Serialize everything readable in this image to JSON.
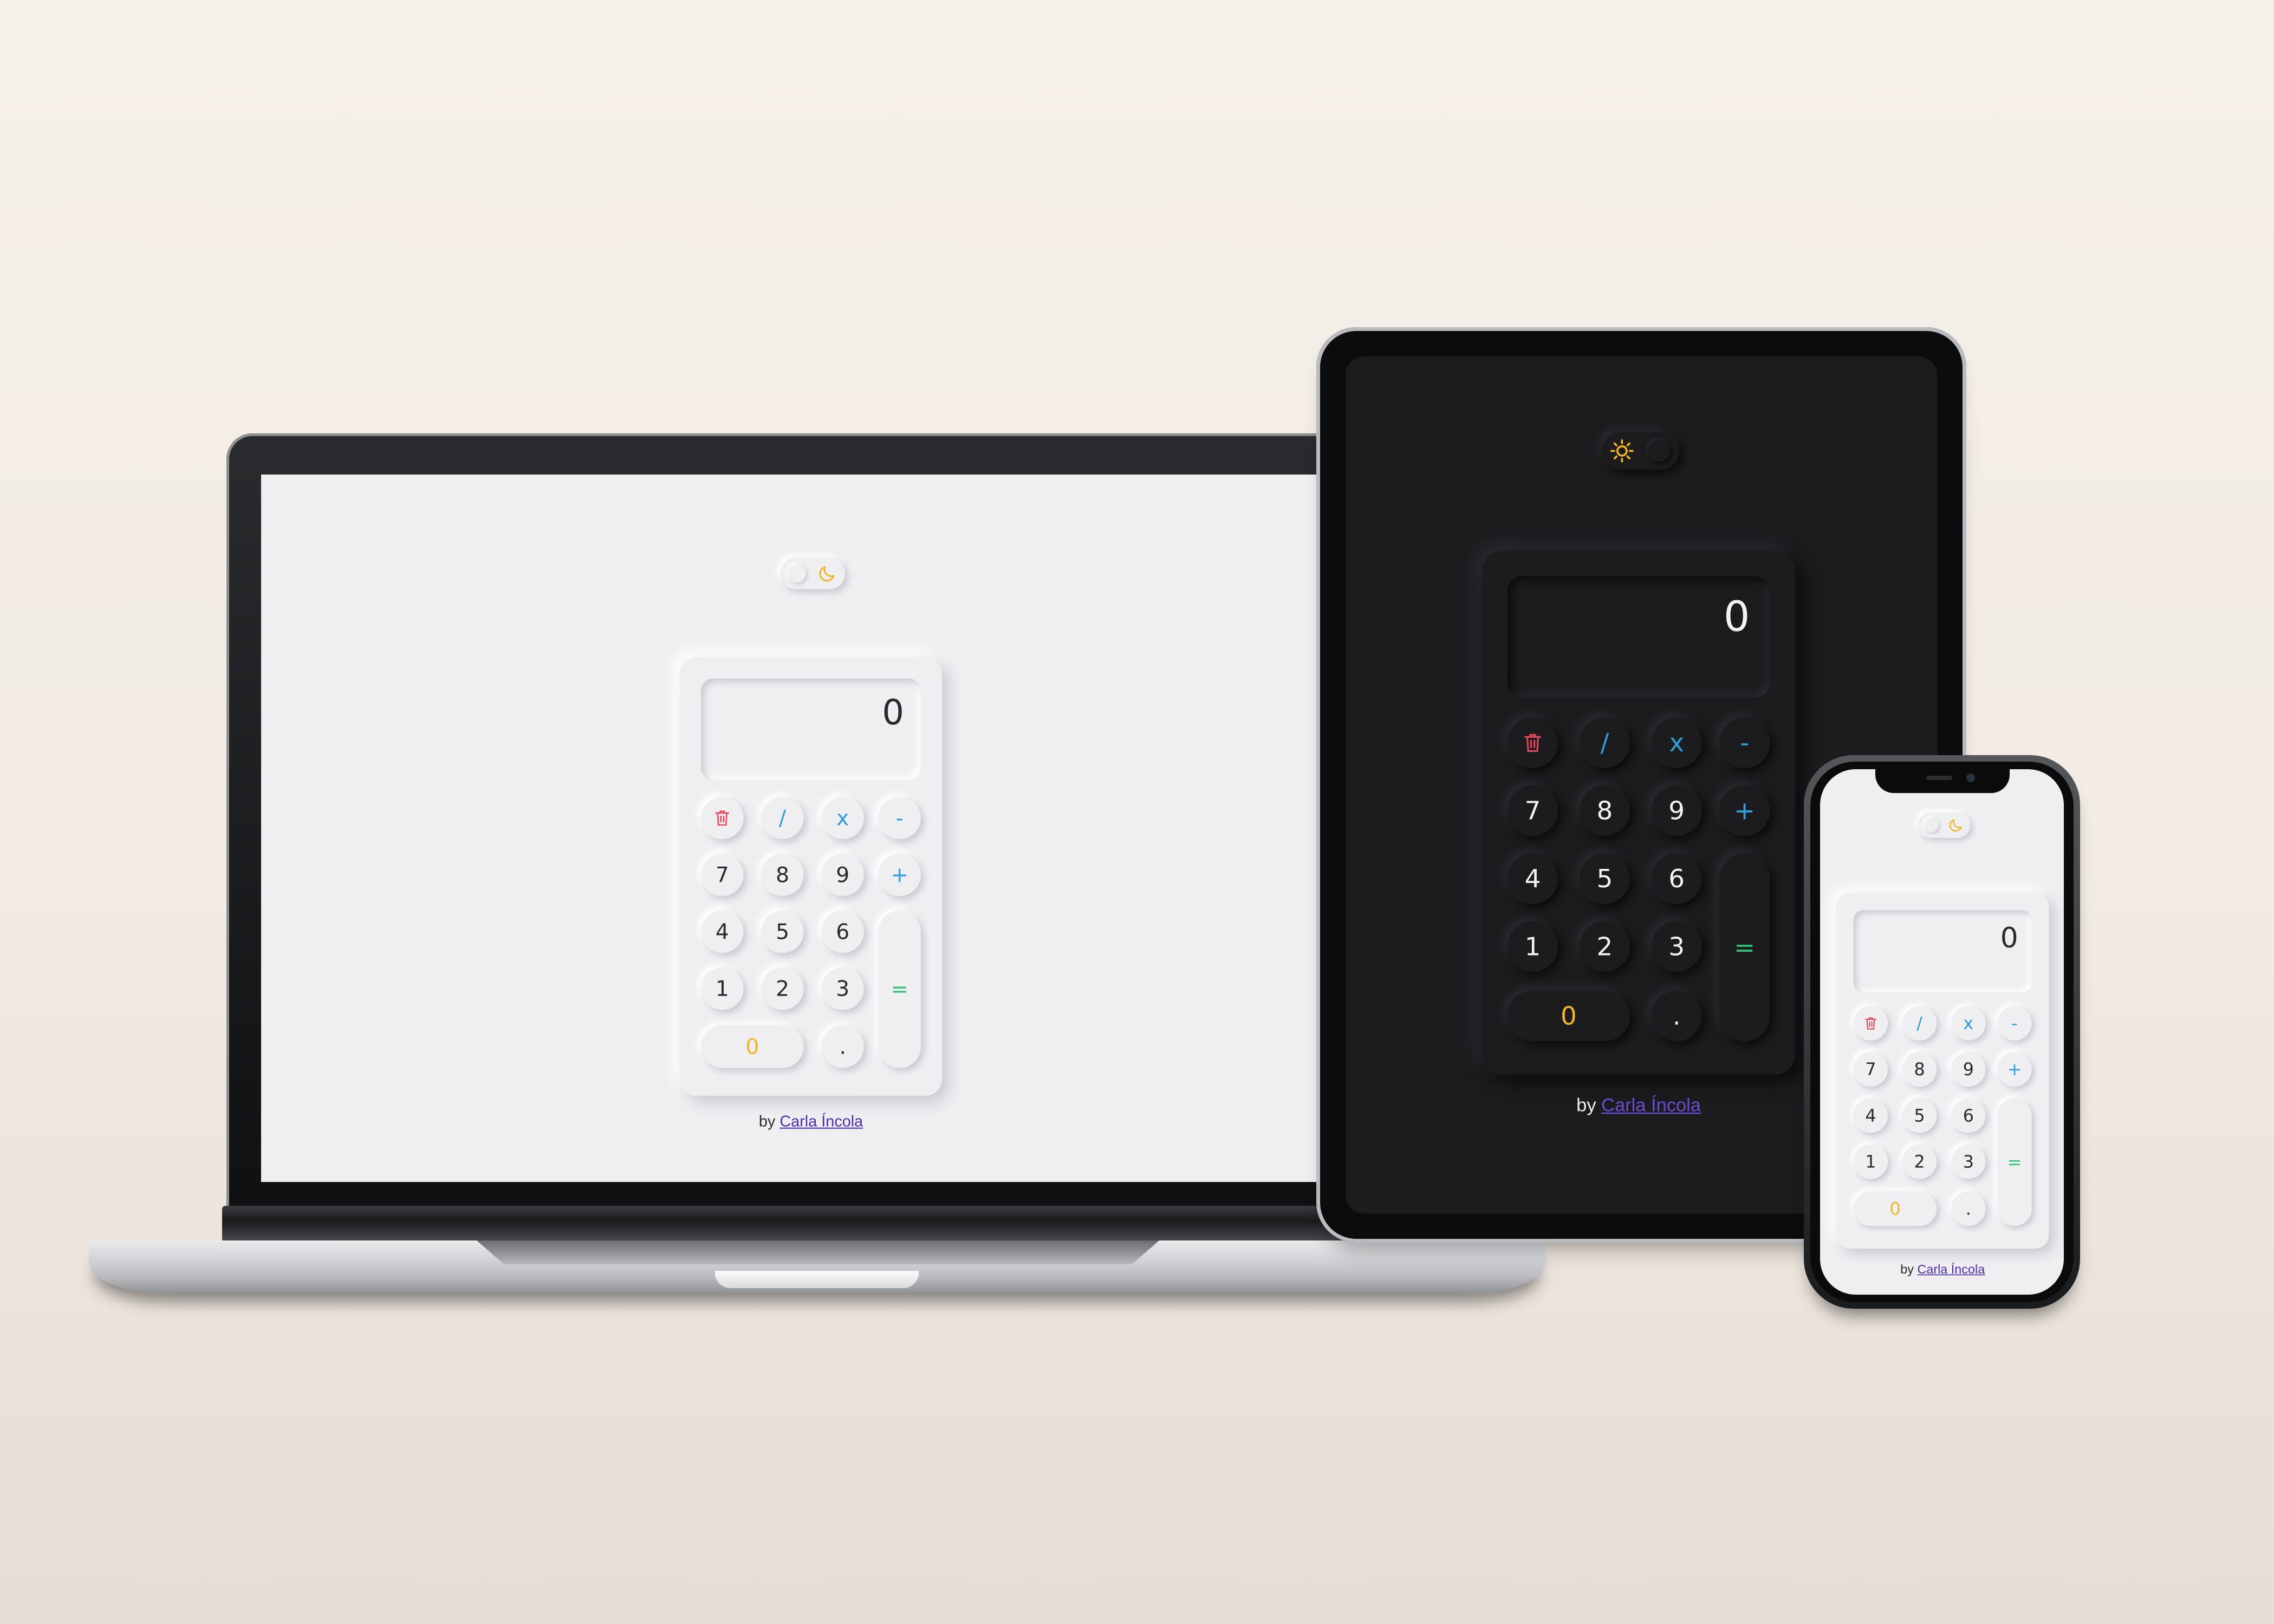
{
  "calculator": {
    "display": "0",
    "keys": {
      "clear_icon": "trash-icon",
      "divide": "/",
      "multiply": "x",
      "minus": "-",
      "plus": "+",
      "equals": "=",
      "seven": "7",
      "eight": "8",
      "nine": "9",
      "four": "4",
      "five": "5",
      "six": "6",
      "one": "1",
      "two": "2",
      "three": "3",
      "zero": "0",
      "dot": "."
    },
    "credit_prefix": "by",
    "credit_author": "Carla Íncola",
    "toggle_icons": {
      "light_mode": "moon-icon",
      "dark_mode": "sun-icon"
    }
  },
  "theme": {
    "light_bg": "#efeff2",
    "dark_bg": "#1c1c1f",
    "operator_color": "#2f9fd6",
    "equals_color": "#2fc473",
    "zero_color": "#f0b429",
    "delete_color": "#e5485d",
    "toggle_icon_color": "#f0b429",
    "link_color": "#4b2ea8"
  }
}
